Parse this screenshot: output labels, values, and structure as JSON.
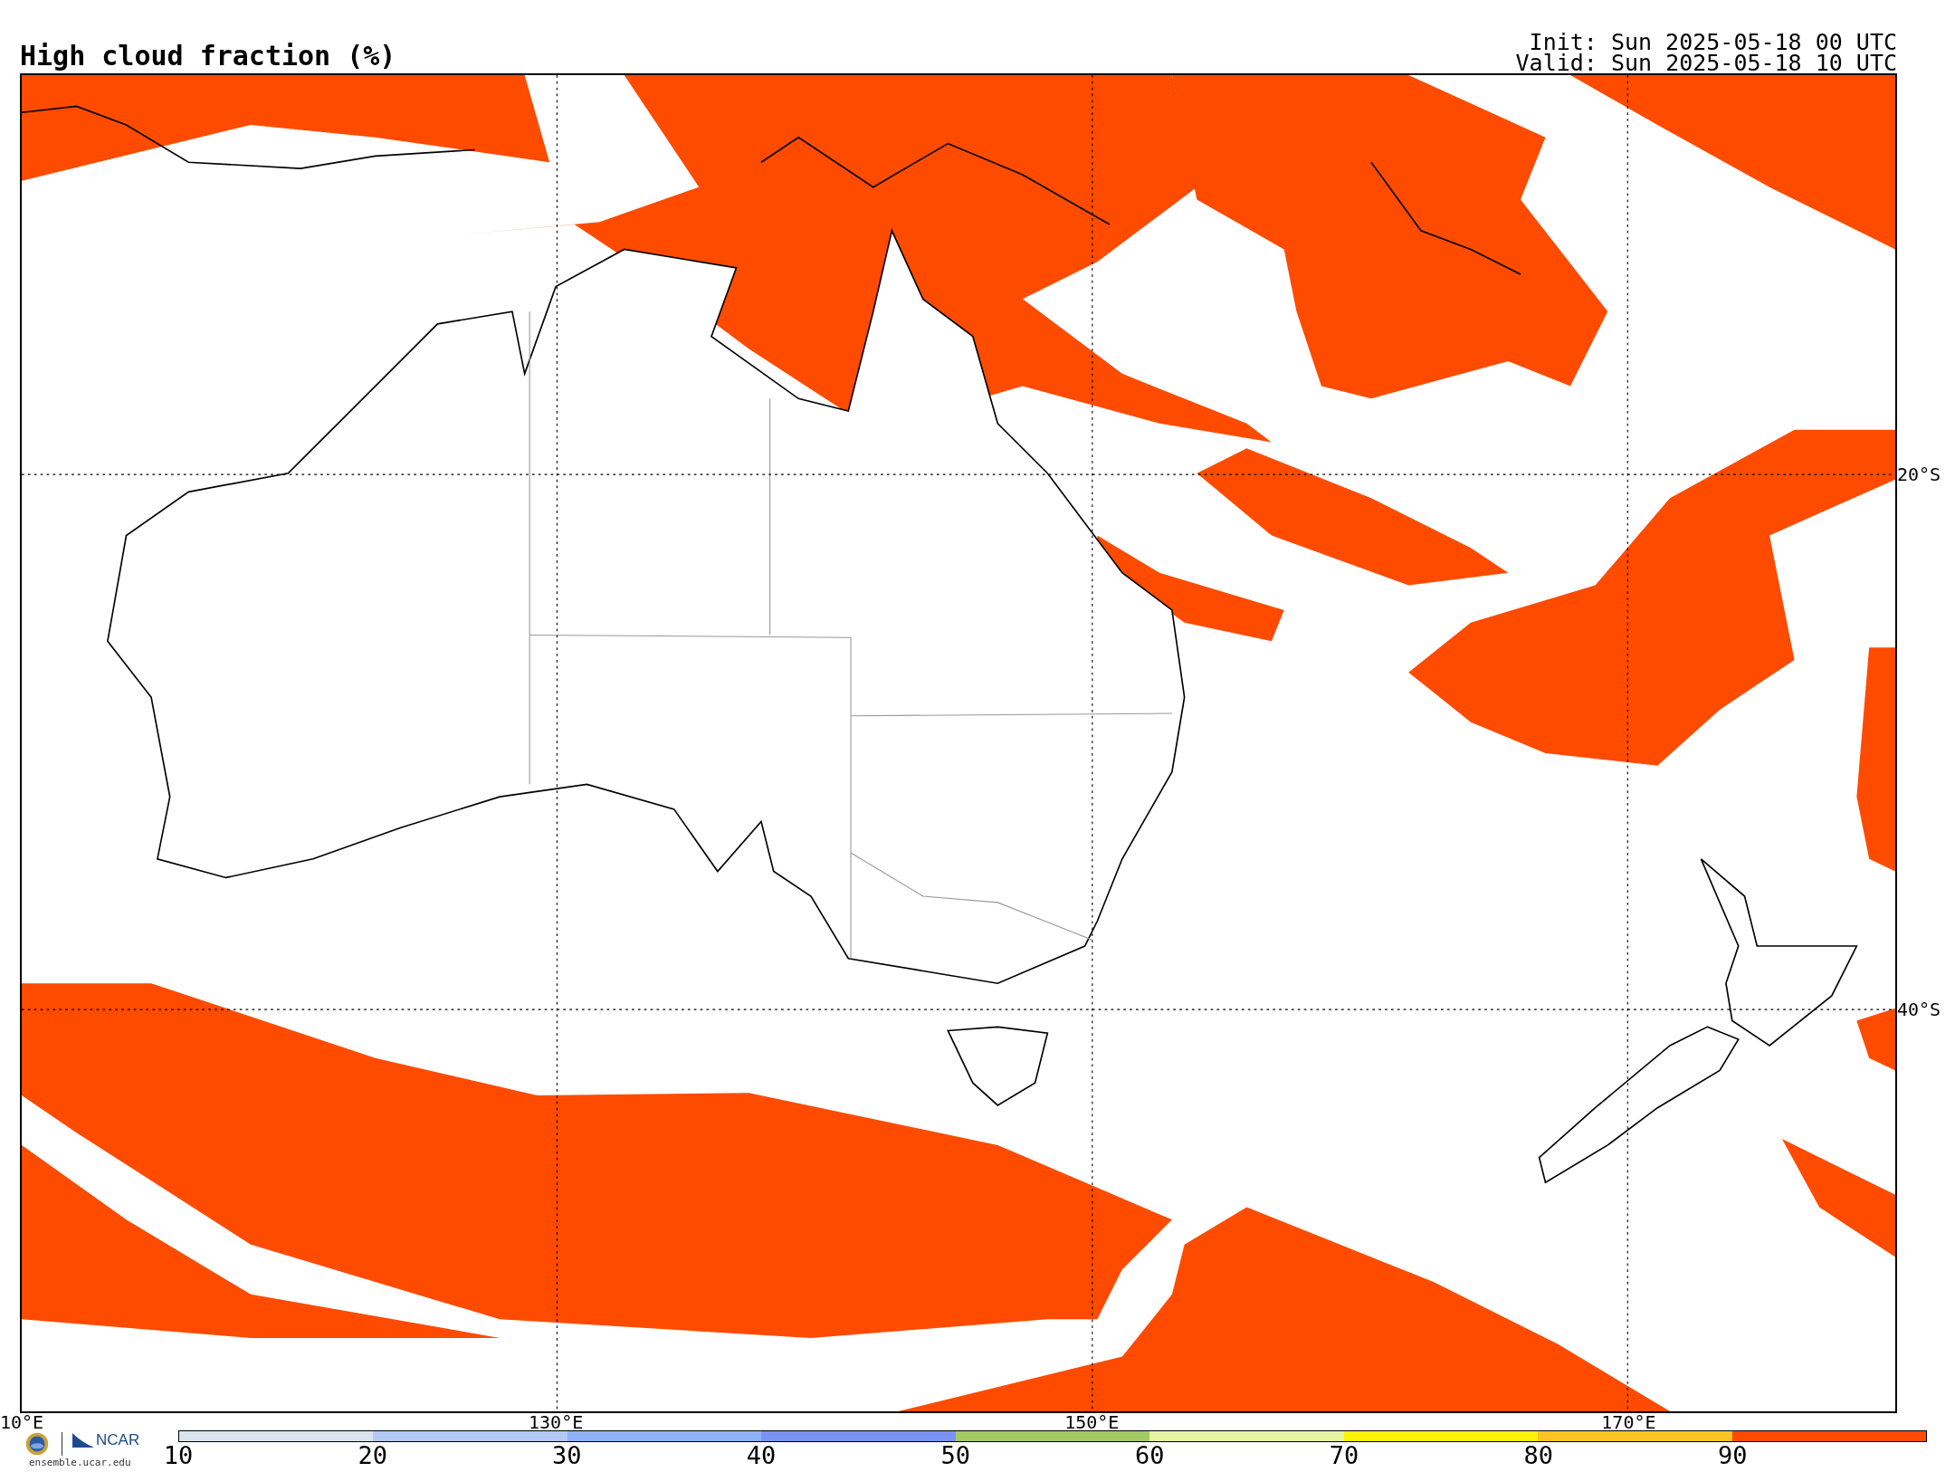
{
  "title": "High cloud fraction (%)",
  "run_info": [
    "Init: Sun 2025-05-18 00 UTC",
    "Valid: Sun 2025-05-18 10 UTC"
  ],
  "map": {
    "lat_labels": [
      "20°S",
      "40°S"
    ],
    "lon_labels": [
      "10°E",
      "130°E",
      "150°E",
      "170°E"
    ]
  },
  "branding": {
    "org": "NCAR",
    "url": "ensemble.ucar.edu"
  },
  "colorbar": {
    "ticks": [
      "10",
      "20",
      "30",
      "40",
      "50",
      "60",
      "70",
      "80",
      "90"
    ],
    "bins": [
      {
        "color": "#d9e4ec"
      },
      {
        "color": "#b4c9f6"
      },
      {
        "color": "#8fb1f6"
      },
      {
        "color": "#7a92f2"
      },
      {
        "color": "#a4cb63"
      },
      {
        "color": "#e6f4a1"
      },
      {
        "color": "#fcf308"
      },
      {
        "color": "#fcc422"
      },
      {
        "color": "#ff4b00"
      }
    ]
  }
}
